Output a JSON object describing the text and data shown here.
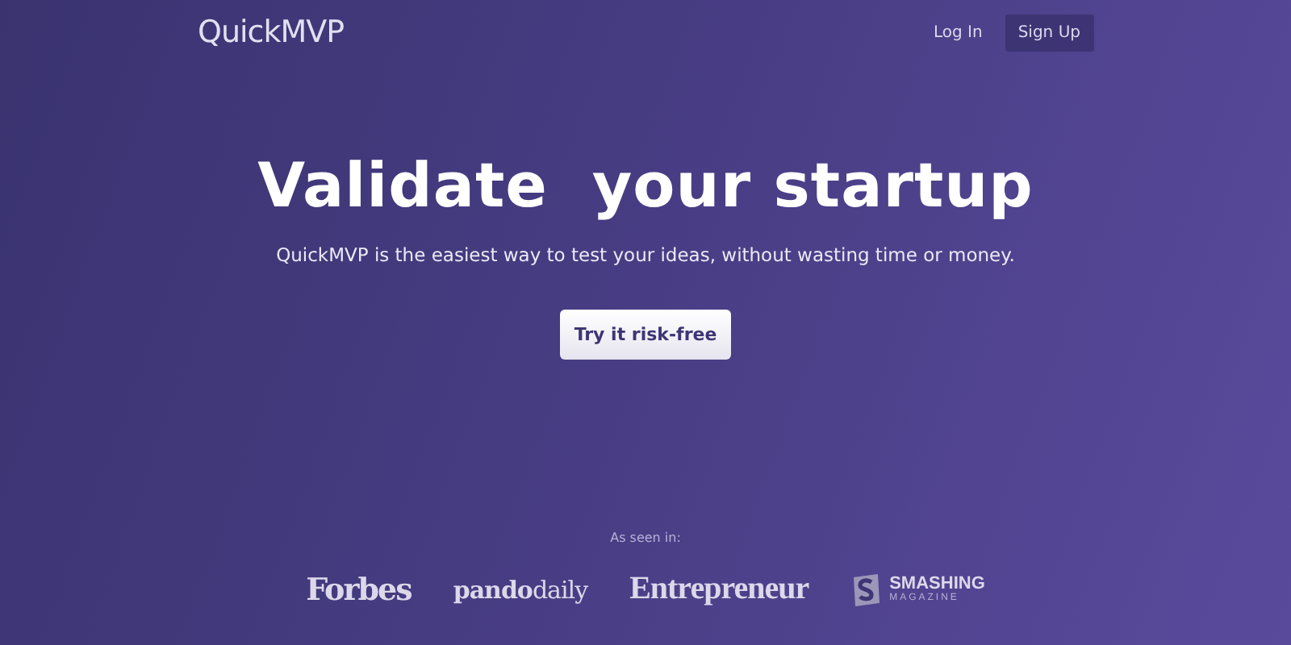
{
  "header": {
    "logo": "QuickMVP",
    "nav": [
      {
        "label": "Log In",
        "kind": "link"
      },
      {
        "label": "Sign Up",
        "kind": "button"
      }
    ]
  },
  "hero": {
    "title": "Validate  your startup",
    "subtitle": "QuickMVP is the easiest way to test your ideas, without wasting time or money.",
    "cta": "Try it risk-free"
  },
  "press": {
    "label": "As seen in:",
    "logos": [
      {
        "kind": "serif",
        "text": "Forbes"
      },
      {
        "kind": "split",
        "text": "**pando**daily"
      },
      {
        "kind": "condensed",
        "text": "Entrepreneur"
      },
      {
        "kind": "badge",
        "text": "SMASHING",
        "subtext": "MAGAZINE"
      }
    ]
  }
}
